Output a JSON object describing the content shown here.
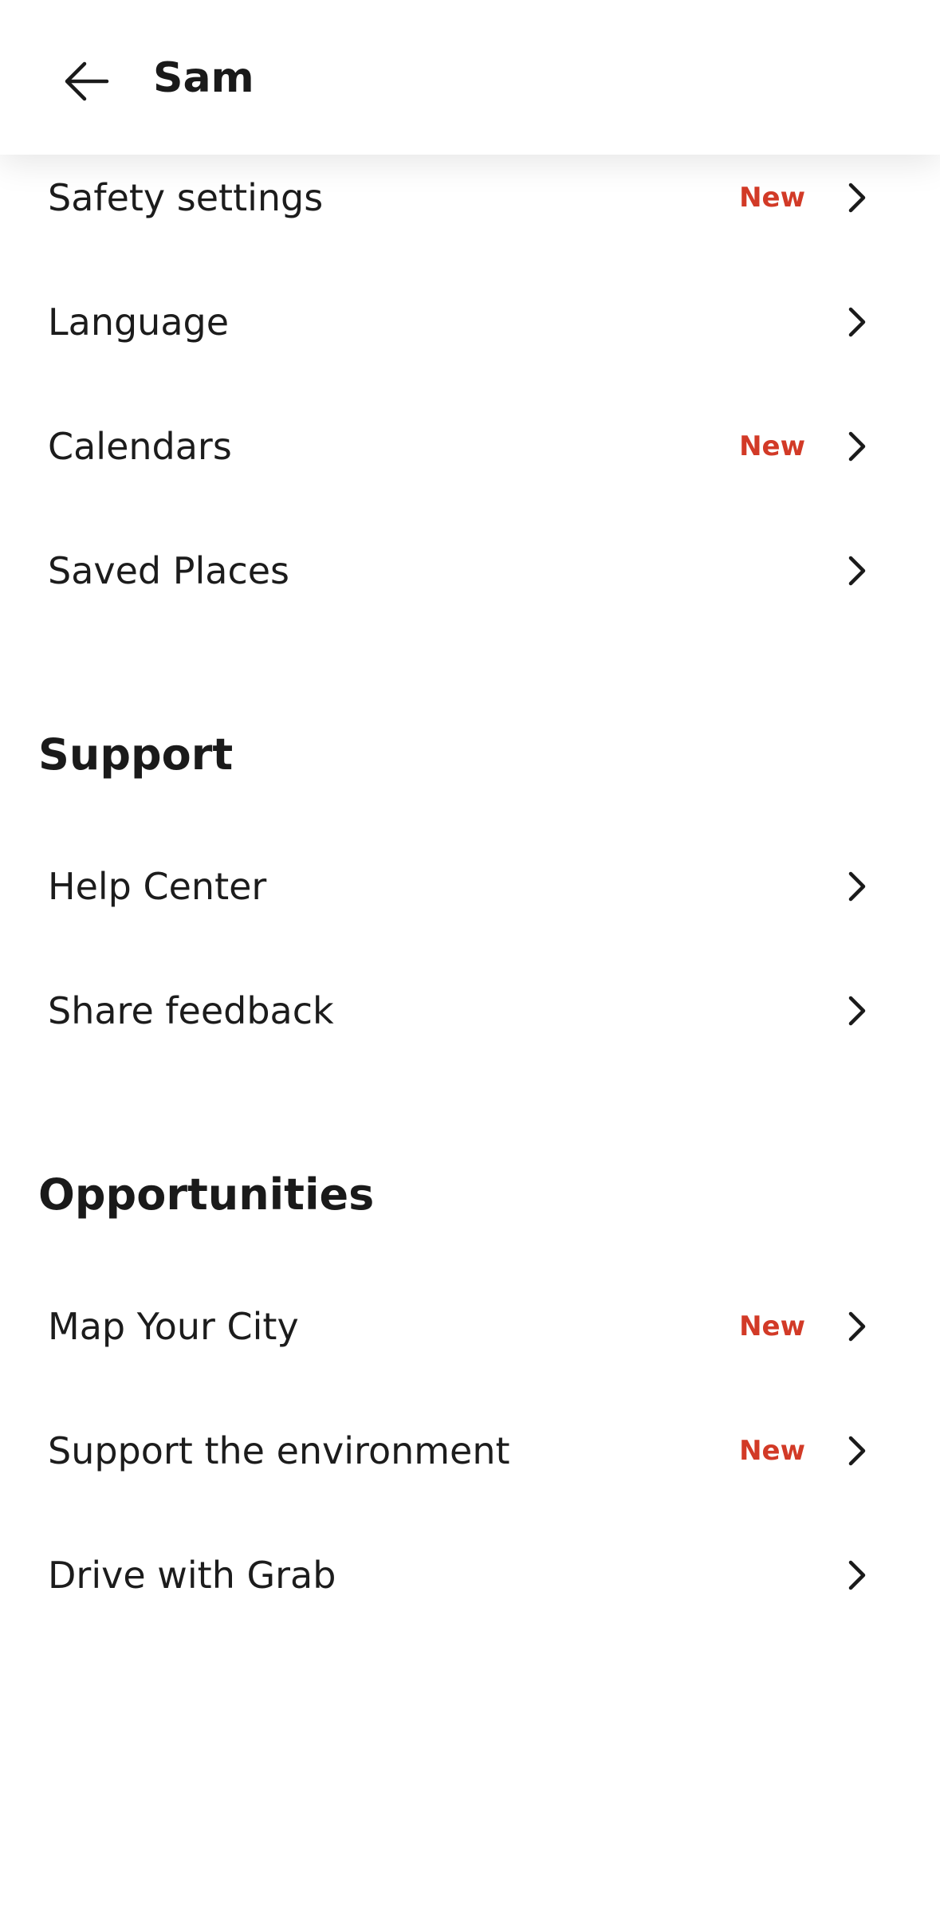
{
  "header": {
    "title": "Sam",
    "back_icon": "arrow-left-icon"
  },
  "colors": {
    "badge": "#d23a27",
    "text": "#1c1c1c",
    "background": "#ffffff"
  },
  "account_items": [
    {
      "label": "Safety settings",
      "badge": "New"
    },
    {
      "label": "Language",
      "badge": ""
    },
    {
      "label": "Calendars",
      "badge": "New"
    },
    {
      "label": "Saved Places",
      "badge": ""
    }
  ],
  "support": {
    "title": "Support",
    "items": [
      {
        "label": "Help Center",
        "badge": ""
      },
      {
        "label": "Share feedback",
        "badge": ""
      }
    ]
  },
  "opportunities": {
    "title": "Opportunities",
    "items": [
      {
        "label": "Map Your City",
        "badge": "New"
      },
      {
        "label": "Support the environment",
        "badge": "New"
      },
      {
        "label": "Drive with Grab",
        "badge": ""
      }
    ]
  }
}
